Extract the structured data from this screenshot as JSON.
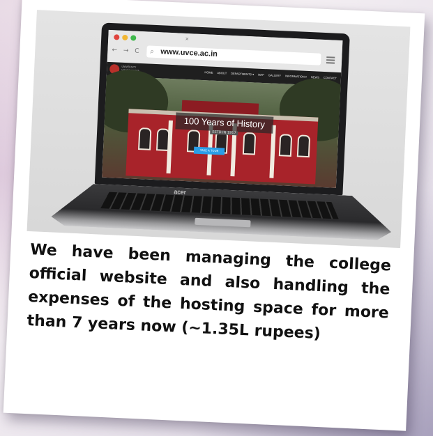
{
  "browser": {
    "url": "www.uvce.ac.in",
    "nav_glyphs": "← → C",
    "tab_close": "×"
  },
  "site": {
    "logo_text": "UNIVERSITY VISVESVARAYA COLLEGE OF ENGINEERING",
    "nav_items": [
      "HOME",
      "ABOUT",
      "DEPARTMENTS ▾",
      "MAP",
      "GALLERY",
      "INFORMATION ▾",
      "NEWS",
      "CONTACT"
    ],
    "hero_title": "100 Years of History",
    "hero_subtitle": "ESTD IN 1917",
    "hero_button": "TAKE A TOUR"
  },
  "laptop_brand": "acer",
  "caption": "We have been managing the college official website and also handling the expenses of the hosting space for more than 7 years now (~1.35L rupees)",
  "colors": {
    "traffic_red": "#e0443e",
    "traffic_yellow": "#f2b632",
    "traffic_green": "#3fb84b",
    "hero_button": "#2a9ee8",
    "building_red": "#a8232a"
  }
}
